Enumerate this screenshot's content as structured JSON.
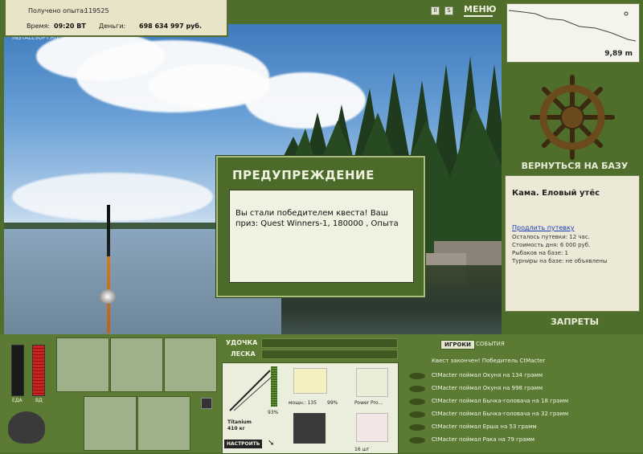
{
  "info": {
    "experience_label": "Получено опыта:",
    "experience_value": "119525",
    "time_label": "Время:",
    "time_value": "09:20 ВТ",
    "money_label": "Деньги:",
    "money_value": "698 634 997 руб.",
    "watermark": "INSTALLSOFT.RU"
  },
  "top_icons": {
    "pause": "II",
    "sound": "S"
  },
  "menu_label": "МЕНЮ",
  "depth": {
    "value": "9,89 m"
  },
  "right": {
    "return_label": "ВЕРНУТЬСЯ НА БАЗУ",
    "base_title": "Кама. Еловый утёс",
    "extend_link": "Продлить путевку",
    "lines": [
      "Осталось путевки: 12 час.",
      "Стоимость дня: 6 000 руб.",
      "Рыбаков на базе: 1",
      "Турниры на базе: не объявлены"
    ],
    "bans_label": "ЗАПРЕТЫ"
  },
  "dialog": {
    "title": "ПРЕДУПРЕЖДЕНИЕ",
    "text": "Вы стали победителем квеста! Ваш приз: Quest Winners-1, 180000 , Опыта"
  },
  "bottom": {
    "food_label": "ЕДА",
    "vd_label": "ВД",
    "rod_label": "УДОЧКА",
    "line_label": "ЛЕСКА",
    "rod_pct": "93%",
    "rod_name": "Titanium",
    "rod_weight": "410 кг",
    "adjust_label": "НАСТРОИТЬ",
    "reel_power": "мощн.: 135",
    "reel_pct": "99%",
    "line_name": "Power Pro...",
    "hook_pcs": "16 шт"
  },
  "events": {
    "tab_players": "ИГРОКИ",
    "tab_events": "СОБЫТИЯ",
    "items": [
      "Квест закончен! Победитель CtMacter",
      "CtMacter поймал Окуня на 134 грамм",
      "CtMacter поймал Окуня на 998 грамм",
      "CtMacter поймал Бычка-головача на 18 грамм",
      "CtMacter поймал Бычка-головача на 32 грамм",
      "CtMacter поймал Ерша на 53 грамм",
      "CtMacter поймал Рака на 79 грамм"
    ]
  }
}
